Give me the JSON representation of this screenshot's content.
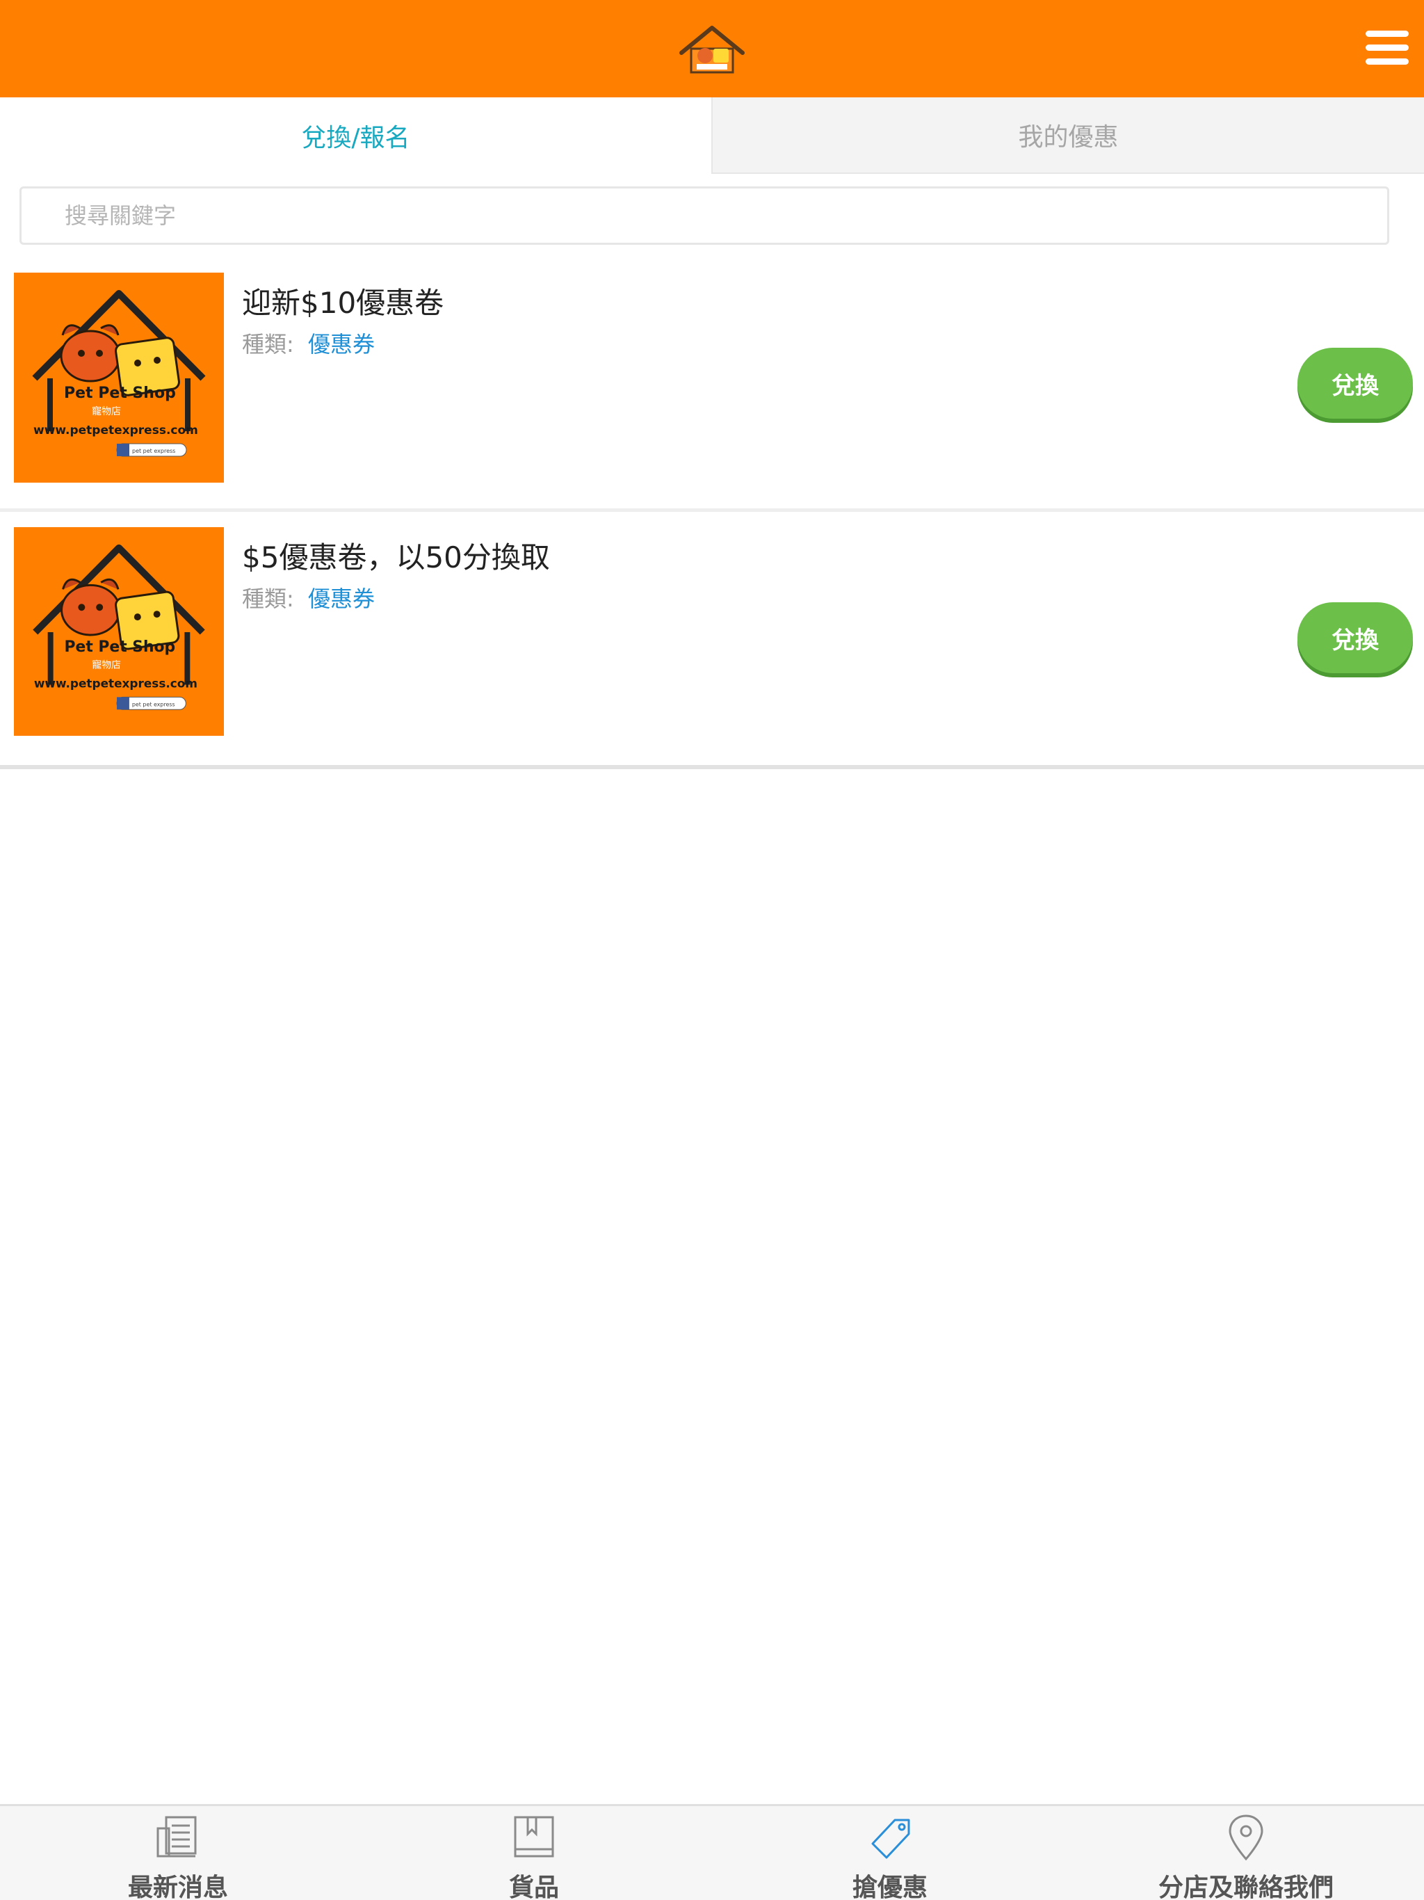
{
  "header": {
    "logo_icon": "pet-house-logo",
    "menu_icon": "hamburger-menu-icon",
    "background_color": "#ff7f00"
  },
  "tabs": [
    {
      "label": "兌換/報名",
      "active": true
    },
    {
      "label": "我的優惠",
      "active": false
    }
  ],
  "search": {
    "placeholder": "搜尋關鍵字",
    "value": ""
  },
  "coupons": [
    {
      "title": "迎新$10優惠卷",
      "type_label": "種類:",
      "type_value": "優惠券",
      "button_label": "兌換",
      "thumb": {
        "brand_text": "Pet Pet Shop",
        "brand_sub": "寵物店",
        "url_text": "www.petpetexpress.com",
        "social_text": "pet pet express"
      }
    },
    {
      "title": "$5優惠卷，以50分換取",
      "type_label": "種類:",
      "type_value": "優惠券",
      "button_label": "兌換",
      "thumb": {
        "brand_text": "Pet Pet Shop",
        "brand_sub": "寵物店",
        "url_text": "www.petpetexpress.com",
        "social_text": "pet pet express"
      }
    }
  ],
  "bottom_nav": [
    {
      "label": "最新消息",
      "icon": "newspaper-icon"
    },
    {
      "label": "貨品",
      "icon": "book-icon"
    },
    {
      "label": "搶優惠",
      "icon": "tag-icon",
      "active": true
    },
    {
      "label": "分店及聯絡我們",
      "icon": "location-pin-icon"
    }
  ],
  "colors": {
    "accent_orange": "#ff7f00",
    "tab_active_text": "#18a8c0",
    "button_green": "#6cc04a",
    "link_blue": "#1f8fd6",
    "nav_active_icon": "#2a8fd8"
  }
}
